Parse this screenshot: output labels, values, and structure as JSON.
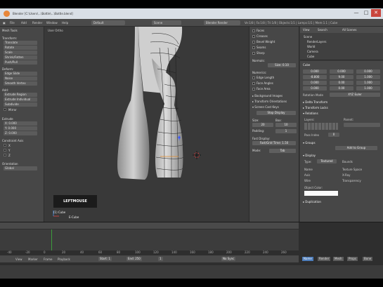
{
  "window": {
    "title": "Blender [C:\\Users\\...\\Bottle\\...\\Bottle.blend]",
    "minimize": "—",
    "maximize": "□",
    "close": "✕"
  },
  "menubar": {
    "items": [
      "File",
      "Add",
      "Render",
      "Window",
      "Help"
    ],
    "layout": "Default",
    "scene": "Scene",
    "engine": "Blender Render",
    "stats": "Ve:1/8 | Fa:1/8 | Tri:1/8 | Objects:1/1 | Lamps:1/1 | Mem:1.1 | Cube"
  },
  "toolshelf": {
    "title": "Mesh Tools",
    "transform_header": "Transform:",
    "transform": [
      "Translate",
      "Rotate",
      "Scale",
      "Shrink/Fatten",
      "Push/Pull"
    ],
    "deform_header": "Deform:",
    "deform": [
      "Edge Slide",
      "Noise",
      "Smooth Vertex"
    ],
    "add_header": "Add:",
    "add": [
      "Extrude Region",
      "Extrude Individual",
      "Subdivide"
    ],
    "mirror_label": "Mirror",
    "fields_header": "Extrude",
    "fields": [
      "X: 0.000",
      "Y: 0.000",
      "Z: 0.000"
    ],
    "constraint_header": "Constraint Axis",
    "checks": [
      "X",
      "Y",
      "Z"
    ],
    "orientation_label": "Orientation",
    "orientation_value": "Global"
  },
  "viewport": {
    "label": "User Ortho",
    "overlay": "LEFTMOUSE",
    "footer": "(1) Cube",
    "footer2": "E-Cube"
  },
  "props_panel": {
    "items": [
      "Faces",
      "Creases",
      "Bevel Weight",
      "Seams",
      "Sharp"
    ],
    "normals_header": "Normals:",
    "normals_btn": "Size: 0.10",
    "numerics_header": "Numerics:",
    "numerics": [
      "Edge Length",
      "Face Angles",
      "Face Area"
    ],
    "sections": [
      "Background Images",
      "Transform Orientations",
      "Screen Cast Keys"
    ],
    "display_btn": "Stop Display",
    "sizes": [
      {
        "label": "Size:",
        "value": "20"
      },
      {
        "label": "Box:",
        "value": "10"
      },
      {
        "label": "Padding:",
        "value": "1"
      },
      {
        "label": "Mode:",
        "value": "Tab"
      }
    ],
    "fast_label": "Fast Display:",
    "fast_value": "Fast/Grid Time: 1.50",
    "mode_label": "Mode:",
    "mode_value": "Tab"
  },
  "outliner": {
    "view": "View",
    "search": "Search",
    "all_scenes": "All Scenes",
    "items": [
      "Scene",
      "RenderLayers",
      "World",
      "Camera",
      "Cube"
    ]
  },
  "properties": {
    "object_label": "Cube",
    "fields": [
      "0.000",
      "0.000",
      "0.000",
      "-8.800",
      "9.00",
      "1.000",
      "0.000",
      "0.00",
      "1.000",
      "0.000",
      "0.00",
      "1.000"
    ],
    "rotation_mode": "Rotation Mode",
    "rotation_value": "XYZ Euler",
    "sections": [
      "Delta Transform",
      "Transform Locks",
      "Relations"
    ],
    "layers_label": "Layers:",
    "parent_label": "Parent:",
    "pass_label": "Pass Index",
    "pass_value": "0",
    "groups_header": "Groups",
    "groups_btn": "Add to Group",
    "display_header": "Display",
    "type_label": "Type:",
    "type_value": "Textured",
    "display_opts": [
      "Name",
      "Axis",
      "Wire",
      "Bounds",
      "Texture Space",
      "X-Ray",
      "Transparency"
    ],
    "color_label": "Object Color:",
    "duplication": "Duplication"
  },
  "timeline": {
    "view": "View",
    "marker": "Marker",
    "frame": "Frame",
    "playback": "Playback",
    "start": "Start: 1",
    "end": "End: 250",
    "current": "1",
    "sync": "No Sync",
    "ticks": [
      "-40",
      "-20",
      "0",
      "20",
      "40",
      "60",
      "80",
      "100",
      "120",
      "140",
      "160",
      "180",
      "200",
      "220",
      "240",
      "260"
    ]
  },
  "bottom_tabs": [
    "Name",
    "Render",
    "Mesh",
    "Props",
    "Bone"
  ]
}
